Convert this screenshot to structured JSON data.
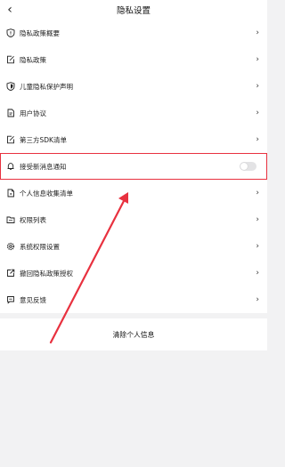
{
  "header": {
    "title": "隐私设置",
    "back_icon": "back-arrow-icon"
  },
  "items": [
    {
      "label": "隐私政策概要",
      "icon": "shield-info-icon",
      "control": "chevron"
    },
    {
      "label": "隐私政策",
      "icon": "edit-doc-icon",
      "control": "chevron"
    },
    {
      "label": "儿童隐私保护声明",
      "icon": "shield-icon",
      "control": "chevron"
    },
    {
      "label": "用户协议",
      "icon": "document-icon",
      "control": "chevron"
    },
    {
      "label": "第三方SDK清单",
      "icon": "edit-doc-icon",
      "control": "chevron"
    },
    {
      "label": "接受新消息通知",
      "icon": "bell-icon",
      "control": "toggle",
      "enabled": false
    },
    {
      "label": "个人信息收集清单",
      "icon": "file-icon",
      "control": "chevron"
    },
    {
      "label": "权限列表",
      "icon": "folder-icon",
      "control": "chevron"
    },
    {
      "label": "系统权限设置",
      "icon": "gear-icon",
      "control": "chevron"
    },
    {
      "label": "撤回隐私政策授权",
      "icon": "external-link-icon",
      "control": "chevron"
    },
    {
      "label": "意见反馈",
      "icon": "feedback-icon",
      "control": "chevron"
    }
  ],
  "clear_button": {
    "label": "清除个人信息"
  },
  "colors": {
    "highlight": "#e8313f",
    "background": "#f2f2f3"
  }
}
